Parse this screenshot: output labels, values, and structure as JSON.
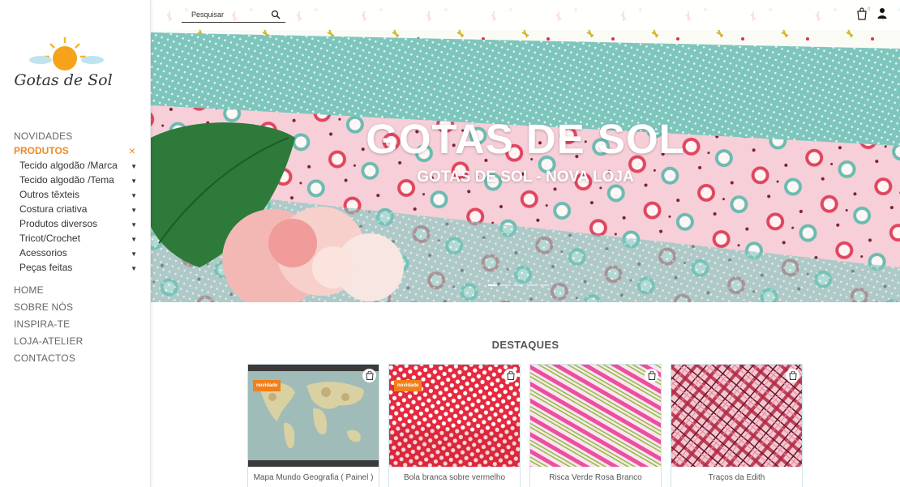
{
  "brand": {
    "logo_text": "Gotas de Sol"
  },
  "header": {
    "search_placeholder": "Pesquisar",
    "cart_count": "0"
  },
  "nav": {
    "novidades": "NOVIDADES",
    "produtos": "PRODUTOS",
    "close_symbol": "×",
    "sub_items": [
      "Tecido algodão /Marca",
      "Tecido algodão /Tema",
      "Outros têxteis",
      "Costura criativa",
      "Produtos diversos",
      "Tricot/Crochet",
      "Acessorios",
      "Peças feitas"
    ],
    "lower_items": [
      "HOME",
      "SOBRE NÓS",
      "INSPIRA-TE",
      "LOJA-ATELIER",
      "CONTACTOS"
    ]
  },
  "hero": {
    "title": "GOTAS DE SOL",
    "subtitle": "GOTAS DE SOL - NOVA LOJA",
    "slides": 5,
    "active_slide": 1
  },
  "featured": {
    "title": "DESTAQUES",
    "badge_label": "novidade",
    "products": [
      {
        "name": "Mapa Mundo Geografia ( Painel )",
        "badge": true
      },
      {
        "name": "Bola branca sobre vermelho",
        "badge": true
      },
      {
        "name": "Risca Verde Rosa Branco",
        "badge": false
      },
      {
        "name": "Traços da Edith",
        "badge": false
      }
    ]
  },
  "colors": {
    "accent": "#f08a24",
    "badge": "#f27f1b"
  }
}
